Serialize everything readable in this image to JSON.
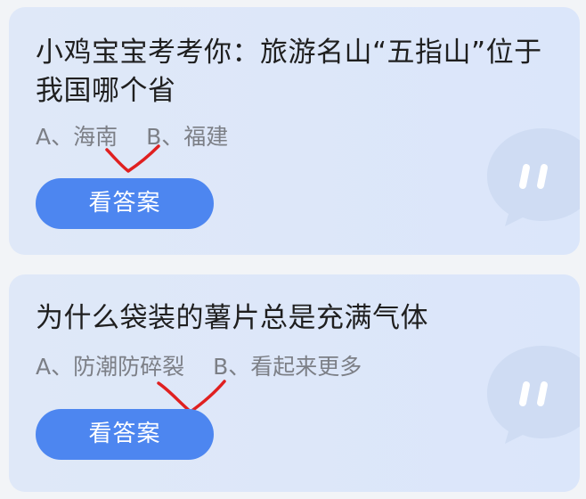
{
  "questions": [
    {
      "text": "小鸡宝宝考考你：旅游名山“五指山”位于我国哪个省",
      "options": [
        "A、海南",
        "B、福建"
      ],
      "button_label": "看答案"
    },
    {
      "text": "为什么袋装的薯片总是充满气体",
      "options": [
        "A、防潮防碎裂",
        "B、看起来更多"
      ],
      "button_label": "看答案"
    }
  ],
  "colors": {
    "card_background": "#dce6f9",
    "button": "#4d86f0",
    "checkmark": "#e02020",
    "question_text": "#1f1f1f",
    "option_text": "#7c7f86"
  },
  "icons": {
    "decoration": "chat-bubble-icon",
    "answer_mark": "checkmark-icon"
  }
}
